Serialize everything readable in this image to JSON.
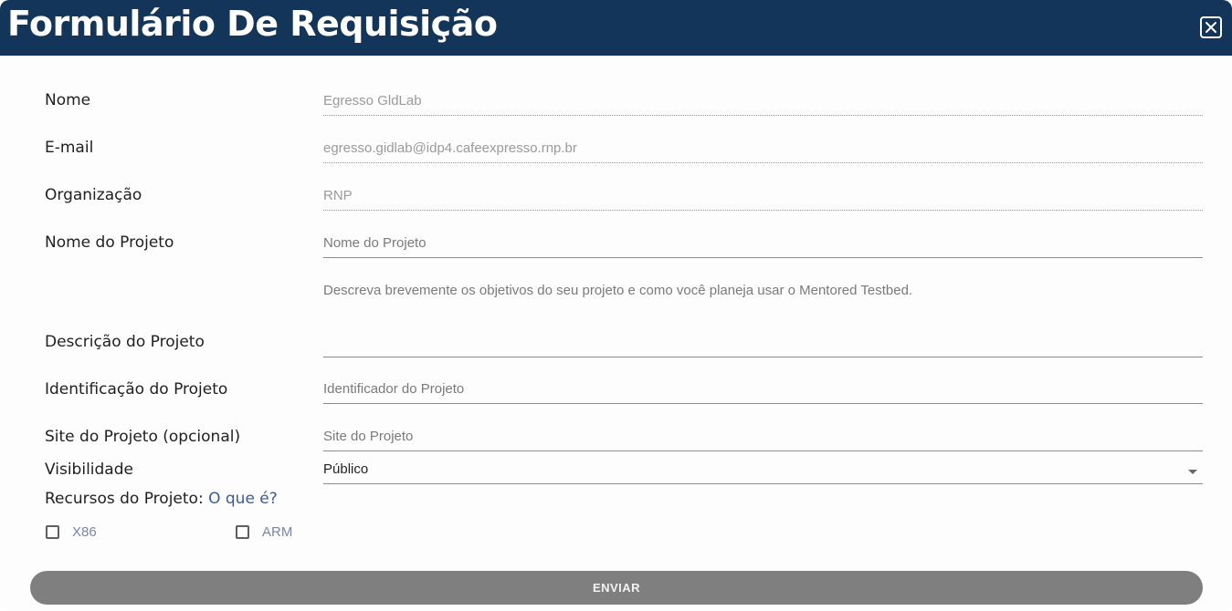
{
  "header": {
    "title": "Formulário De Requisição",
    "close_icon": "close-x-icon",
    "background": "#133559"
  },
  "form": {
    "name": {
      "label": "Nome",
      "value": "Egresso GldLab"
    },
    "email": {
      "label": "E-mail",
      "value": "egresso.gidlab@idp4.cafeexpresso.rnp.br"
    },
    "organization": {
      "label": "Organização",
      "value": "RNP"
    },
    "project_name": {
      "label": "Nome do Projeto",
      "placeholder": "Nome do Projeto"
    },
    "project_description": {
      "label": "Descrição do Projeto",
      "placeholder": "Descreva brevemente os objetivos do seu projeto e como você planeja usar o Mentored Testbed."
    },
    "project_id": {
      "label": "Identificação do Projeto",
      "placeholder": "Identificador do Projeto"
    },
    "project_site": {
      "label": "Site do Projeto (opcional)",
      "placeholder": "Site do Projeto"
    },
    "visibility": {
      "label": "Visibilidade",
      "value": "Público"
    },
    "resources": {
      "label": "Recursos do Projeto:",
      "help_link": "O que é?",
      "options": [
        {
          "label": "X86",
          "checked": false
        },
        {
          "label": "ARM",
          "checked": false
        }
      ]
    },
    "submit_label": "ENVIAR"
  }
}
